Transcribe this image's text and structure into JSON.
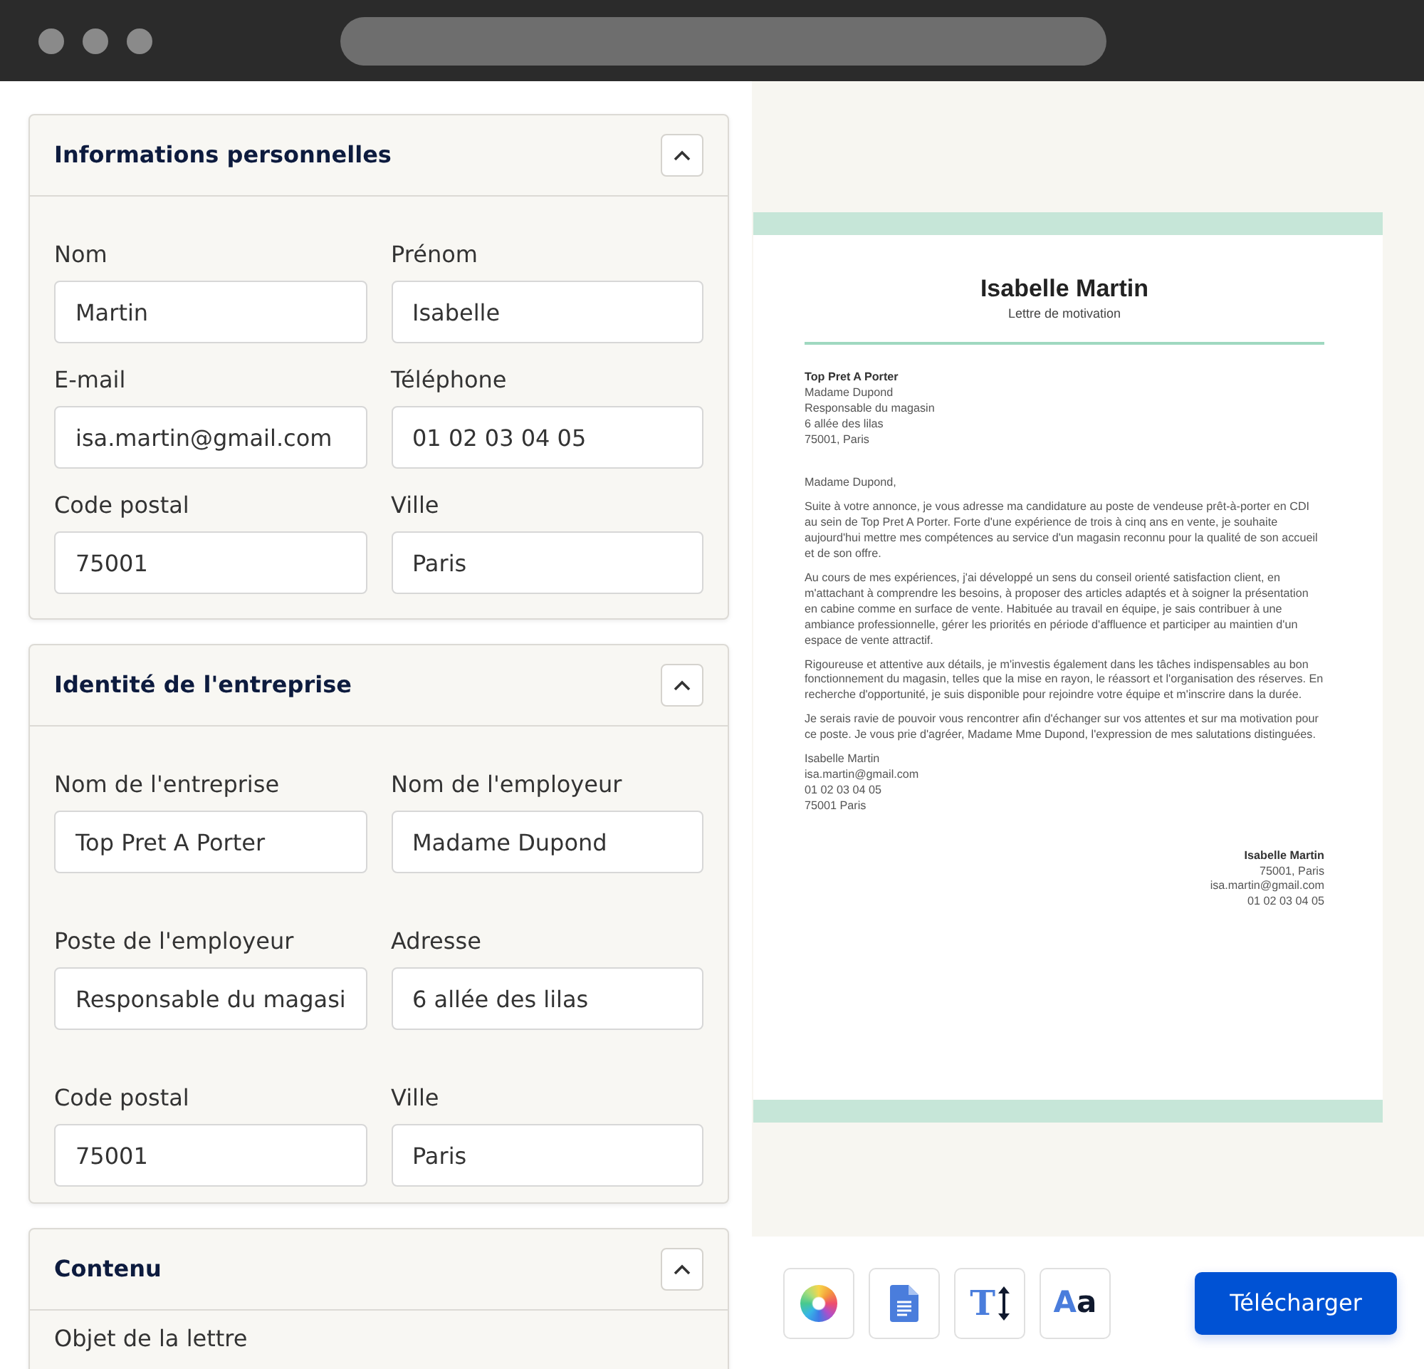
{
  "sections": [
    {
      "title": "Informations personnelles",
      "expanded": true,
      "fields": [
        {
          "label": "Nom",
          "value": "Martin"
        },
        {
          "label": "Prénom",
          "value": "Isabelle"
        },
        {
          "label": "E-mail",
          "value": "isa.martin@gmail.com"
        },
        {
          "label": "Téléphone",
          "value": "01 02 03 04 05"
        },
        {
          "label": "Code postal",
          "value": "75001"
        },
        {
          "label": "Ville",
          "value": "Paris"
        }
      ]
    },
    {
      "title": "Identité de l'entreprise",
      "expanded": true,
      "fields": [
        {
          "label": "Nom de l'entreprise",
          "value": "Top Pret A Porter"
        },
        {
          "label": "Nom de l'employeur",
          "value": "Madame Dupond"
        },
        {
          "label": "Poste de l'employeur",
          "value": "Responsable du magasi"
        },
        {
          "label": "Adresse",
          "value": "6 allée des lilas"
        },
        {
          "label": "Code postal",
          "value": "75001"
        },
        {
          "label": "Ville",
          "value": "Paris"
        }
      ]
    },
    {
      "title": "Contenu",
      "expanded": true,
      "fields": [
        {
          "label": "Objet de la lettre"
        }
      ]
    }
  ],
  "letter": {
    "name": "Isabelle Martin",
    "subtitle": "Lettre de motivation",
    "recipient": [
      "Top Pret A Porter",
      "Madame Dupond",
      "Responsable du magasin",
      "6 allée des lilas",
      "75001, Paris"
    ],
    "salutation": "Madame Dupond,",
    "paragraphs": [
      "Suite à votre annonce, je vous adresse ma candidature au poste de vendeuse prêt-à-porter en CDI au sein de Top Pret A Porter. Forte d'une expérience de trois à cinq ans en vente, je souhaite aujourd'hui mettre mes compétences au service d'un magasin reconnu pour la qualité de son accueil et de son offre.",
      "Au cours de mes expériences, j'ai développé un sens du conseil orienté satisfaction client, en m'attachant à comprendre les besoins, à proposer des articles adaptés et à soigner la présentation en cabine comme en surface de vente. Habituée au travail en équipe, je sais contribuer à une ambiance professionnelle, gérer les priorités en période d'affluence et participer au maintien d'un espace de vente attractif.",
      "Rigoureuse et attentive aux détails, je m'investis également dans les tâches indispensables au bon fonctionnement du magasin, telles que la mise en rayon, le réassort et l'organisation des réserves. En recherche d'opportunité, je suis disponible pour rejoindre votre équipe et m'inscrire dans la durée.",
      "Je serais ravie de pouvoir vous rencontrer afin d'échanger sur vos attentes et sur ma motivation pour ce poste. Je vous prie d'agréer, Madame Mme Dupond, l'expression de mes salutations distinguées."
    ],
    "closing": [
      "Isabelle Martin",
      "isa.martin@gmail.com",
      "01 02 03 04 05",
      "75001 Paris"
    ],
    "signature": [
      "Isabelle Martin",
      "75001, Paris",
      "isa.martin@gmail.com",
      "01 02 03 04 05"
    ]
  },
  "toolbar": {
    "tools": [
      {
        "kind": "colors"
      },
      {
        "kind": "document"
      },
      {
        "kind": "text-size",
        "glyph": "T"
      },
      {
        "kind": "font",
        "glyph": "Aa"
      }
    ],
    "download": "Télécharger"
  }
}
